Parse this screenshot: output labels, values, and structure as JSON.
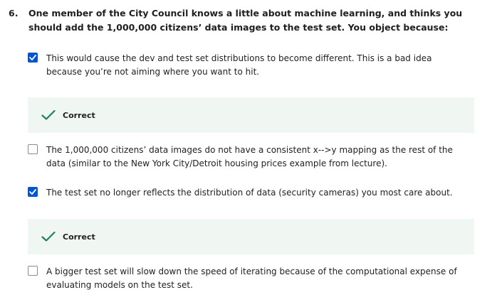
{
  "question": {
    "number": "6.",
    "text": "One member of the City Council knows a little about machine learning, and thinks you should add the 1,000,000 citizens’ data images to the test set. You object because:"
  },
  "options": [
    {
      "text": "This would cause the dev and test set distributions to become different. This is a bad idea because you’re not aiming where you want to hit.",
      "checked": true,
      "feedback": "Correct"
    },
    {
      "text": "The 1,000,000 citizens’ data images do not have a consistent x-->y mapping as the rest of the data (similar to the New York City/Detroit housing prices example from lecture).",
      "checked": false
    },
    {
      "text": "The test set no longer reflects the distribution of data (security cameras) you most care about.",
      "checked": true,
      "feedback": "Correct"
    },
    {
      "text": "A bigger test set will slow down the speed of iterating because of the computational expense of evaluating models on the test set.",
      "checked": false
    }
  ],
  "colors": {
    "checkbox_checked": "#0056d2",
    "feedback_background": "#f0f6f2",
    "correct_icon": "#1f8354"
  },
  "icons": {
    "checked": "checkmark-icon",
    "correct": "correct-check-icon"
  }
}
